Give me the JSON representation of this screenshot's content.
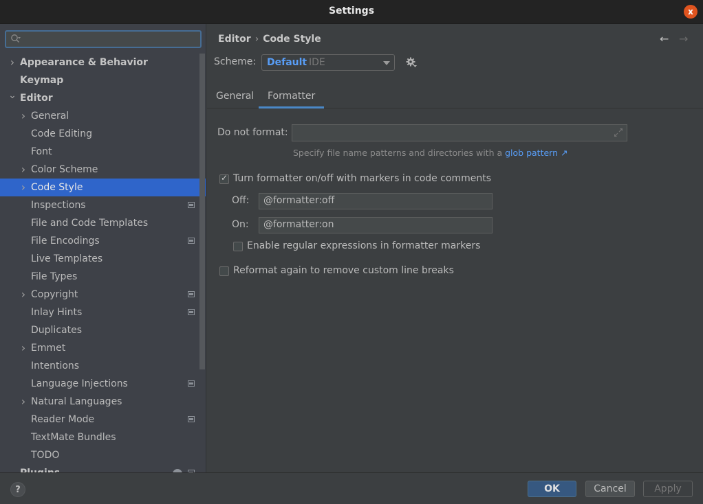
{
  "window": {
    "title": "Settings",
    "close_label": "x"
  },
  "sidebar": {
    "search": {
      "value": "",
      "placeholder": ""
    },
    "items": [
      {
        "label": "Appearance & Behavior",
        "level": 0,
        "bold": true,
        "chevron": "right"
      },
      {
        "label": "Keymap",
        "level": 0,
        "bold": true,
        "chevron": ""
      },
      {
        "label": "Editor",
        "level": 0,
        "bold": true,
        "chevron": "down"
      },
      {
        "label": "General",
        "level": 1,
        "chevron": "right"
      },
      {
        "label": "Code Editing",
        "level": 1,
        "chevron": ""
      },
      {
        "label": "Font",
        "level": 1,
        "chevron": ""
      },
      {
        "label": "Color Scheme",
        "level": 1,
        "chevron": "right"
      },
      {
        "label": "Code Style",
        "level": 1,
        "chevron": "right",
        "selected": true
      },
      {
        "label": "Inspections",
        "level": 1,
        "chevron": "",
        "project_icon": true
      },
      {
        "label": "File and Code Templates",
        "level": 1,
        "chevron": ""
      },
      {
        "label": "File Encodings",
        "level": 1,
        "chevron": "",
        "project_icon": true
      },
      {
        "label": "Live Templates",
        "level": 1,
        "chevron": ""
      },
      {
        "label": "File Types",
        "level": 1,
        "chevron": ""
      },
      {
        "label": "Copyright",
        "level": 1,
        "chevron": "right",
        "project_icon": true
      },
      {
        "label": "Inlay Hints",
        "level": 1,
        "chevron": "",
        "project_icon": true
      },
      {
        "label": "Duplicates",
        "level": 1,
        "chevron": ""
      },
      {
        "label": "Emmet",
        "level": 1,
        "chevron": "right"
      },
      {
        "label": "Intentions",
        "level": 1,
        "chevron": ""
      },
      {
        "label": "Language Injections",
        "level": 1,
        "chevron": "",
        "project_icon": true
      },
      {
        "label": "Natural Languages",
        "level": 1,
        "chevron": "right"
      },
      {
        "label": "Reader Mode",
        "level": 1,
        "chevron": "",
        "project_icon": true
      },
      {
        "label": "TextMate Bundles",
        "level": 1,
        "chevron": ""
      },
      {
        "label": "TODO",
        "level": 1,
        "chevron": ""
      },
      {
        "label": "Plugins",
        "level": 0,
        "bold": true,
        "chevron": "",
        "project_icon": true,
        "info_badge": true
      }
    ]
  },
  "main": {
    "breadcrumb": {
      "parent": "Editor",
      "separator": "›",
      "current": "Code Style"
    },
    "nav": {
      "back": "←",
      "forward": "→"
    },
    "scheme": {
      "label": "Scheme:",
      "name": "Default",
      "sub": "IDE"
    },
    "tabs": [
      {
        "label": "General",
        "active": false
      },
      {
        "label": "Formatter",
        "active": true
      }
    ],
    "formatter": {
      "do_not_format_label": "Do not format:",
      "do_not_format_value": "",
      "hint_text": "Specify file name patterns and directories with a",
      "hint_link": "glob pattern ↗",
      "markers_checkbox": {
        "label": "Turn formatter on/off with markers in code comments",
        "checked": true
      },
      "off_label": "Off:",
      "off_value": "@formatter:off",
      "on_label": "On:",
      "on_value": "@formatter:on",
      "regex_checkbox": {
        "label": "Enable regular expressions in formatter markers",
        "checked": false
      },
      "reformat_checkbox": {
        "label": "Reformat again to remove custom line breaks",
        "checked": false
      }
    }
  },
  "footer": {
    "help_label": "?",
    "ok_label": "OK",
    "cancel_label": "Cancel",
    "apply_label": "Apply"
  },
  "colors": {
    "accent": "#2f65ca",
    "link": "#589df6",
    "ok_button": "#365880",
    "close_button": "#e0541f"
  }
}
